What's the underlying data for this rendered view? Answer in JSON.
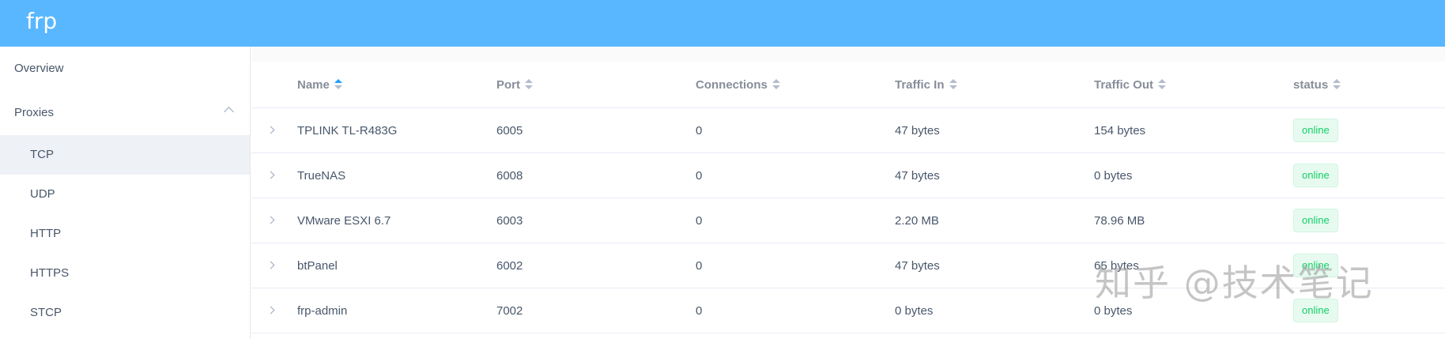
{
  "header": {
    "brand": "frp"
  },
  "sidebar": {
    "items": [
      {
        "label": "Overview"
      },
      {
        "label": "Proxies"
      }
    ],
    "subitems": [
      {
        "label": "TCP"
      },
      {
        "label": "UDP"
      },
      {
        "label": "HTTP"
      },
      {
        "label": "HTTPS"
      },
      {
        "label": "STCP"
      }
    ]
  },
  "table": {
    "columns": [
      "Name",
      "Port",
      "Connections",
      "Traffic In",
      "Traffic Out",
      "status"
    ],
    "rows": [
      {
        "name": "TPLINK TL-R483G",
        "port": "6005",
        "connections": "0",
        "traffic_in": "47 bytes",
        "traffic_out": "154 bytes",
        "status": "online"
      },
      {
        "name": "TrueNAS",
        "port": "6008",
        "connections": "0",
        "traffic_in": "47 bytes",
        "traffic_out": "0 bytes",
        "status": "online"
      },
      {
        "name": "VMware ESXI 6.7",
        "port": "6003",
        "connections": "0",
        "traffic_in": "2.20 MB",
        "traffic_out": "78.96 MB",
        "status": "online"
      },
      {
        "name": "btPanel",
        "port": "6002",
        "connections": "0",
        "traffic_in": "47 bytes",
        "traffic_out": "65 bytes",
        "status": "online"
      },
      {
        "name": "frp-admin",
        "port": "7002",
        "connections": "0",
        "traffic_in": "0 bytes",
        "traffic_out": "0 bytes",
        "status": "online"
      }
    ]
  },
  "watermark": "知乎 @技术笔记"
}
